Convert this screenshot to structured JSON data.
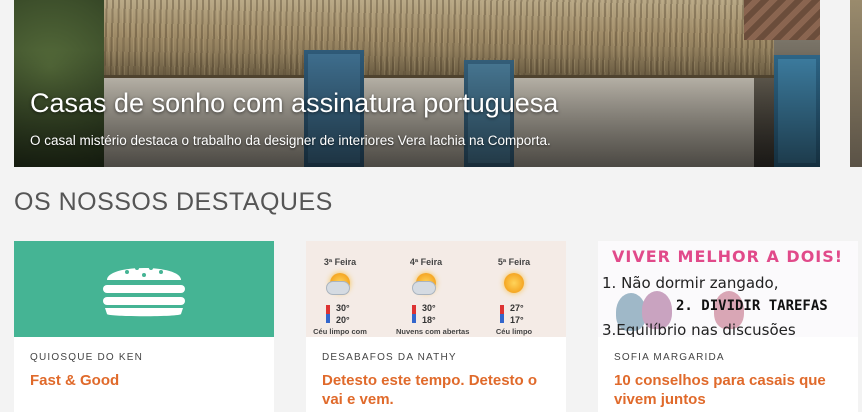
{
  "hero": {
    "title": "Casas de sonho com assinatura portuguesa",
    "subtitle": "O casal mistério destaca o trabalho da designer de interiores Vera Iachia na Comporta."
  },
  "section": {
    "title": "OS NOSSOS DESTAQUES"
  },
  "cards": [
    {
      "author": "QUIOSQUE DO KEN",
      "title": "Fast & Good",
      "icon": "burger-icon",
      "bg_color": "#45b494"
    },
    {
      "author": "DESABAFOS DA NATHY",
      "title": "Detesto este tempo. Detesto o vai e vem.",
      "forecast": [
        {
          "day": "3ª Feira",
          "high": "30°",
          "low": "20°",
          "desc": "Céu limpo com"
        },
        {
          "day": "4ª Feira",
          "high": "30°",
          "low": "18°",
          "desc": "Nuvens com abertas"
        },
        {
          "day": "5ª Feira",
          "high": "27°",
          "low": "17°",
          "desc": "Céu limpo"
        }
      ]
    },
    {
      "author": "SOFIA MARGARIDA",
      "title": "10 conselhos para casais que vivem juntos",
      "image_text": {
        "heading": "VIVER MELHOR A DOIS!",
        "line1": "1. Não dormir zangado,",
        "line2": "2. DIVIDIR TAREFAS",
        "line3": "3.Equilíbrio nas discusões"
      }
    }
  ],
  "colors": {
    "accent": "#e06a2b",
    "heading": "#555555"
  }
}
